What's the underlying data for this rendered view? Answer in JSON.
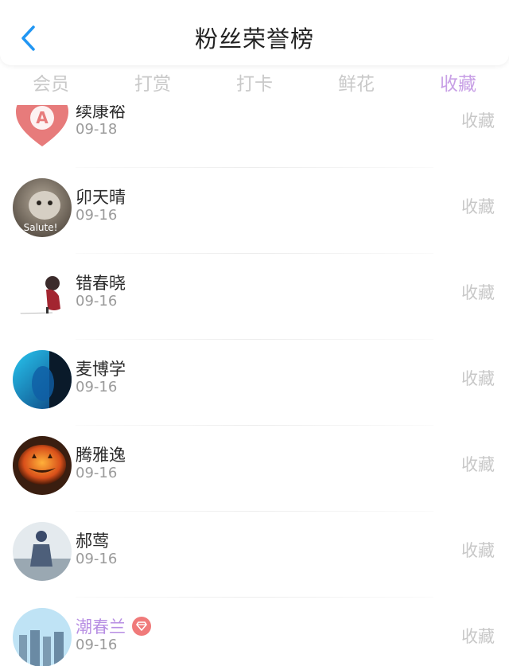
{
  "header": {
    "title": "粉丝荣誉榜"
  },
  "tabs": [
    {
      "label": "会员",
      "active": false
    },
    {
      "label": "打赏",
      "active": false
    },
    {
      "label": "打卡",
      "active": false
    },
    {
      "label": "鲜花",
      "active": false
    },
    {
      "label": "收藏",
      "active": true
    }
  ],
  "list": [
    {
      "name": "续康裕",
      "date": "09-18",
      "action": "收藏"
    },
    {
      "name": "卯天晴",
      "date": "09-16",
      "action": "收藏",
      "avatar_text": "Salute!"
    },
    {
      "name": "错春晓",
      "date": "09-16",
      "action": "收藏"
    },
    {
      "name": "麦博学",
      "date": "09-16",
      "action": "收藏"
    },
    {
      "name": "腾雅逸",
      "date": "09-16",
      "action": "收藏"
    },
    {
      "name": "郝莺",
      "date": "09-16",
      "action": "收藏"
    },
    {
      "name": "潮春兰",
      "date": "09-16",
      "action": "收藏",
      "vip": true
    }
  ],
  "colors": {
    "accent": "#c8a0e6",
    "back": "#2196f3",
    "vip_badge": "#f07a7a"
  }
}
